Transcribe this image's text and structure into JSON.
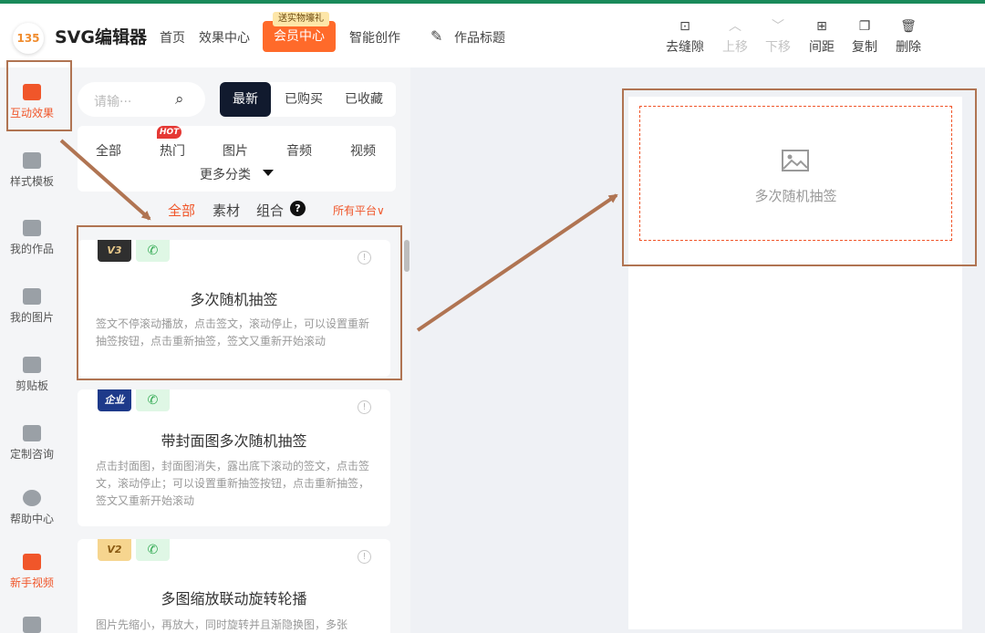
{
  "header": {
    "logo_text": "135",
    "brand": "SVG编辑器",
    "nav": [
      "首页",
      "效果中心"
    ],
    "vip_label": "会员中心",
    "vip_tag": "送实物壕礼",
    "nav2": "智能创作",
    "work_title": "作品标题",
    "tools": [
      {
        "label": "去缝隙",
        "icon": "⊡"
      },
      {
        "label": "上移",
        "icon": "︿"
      },
      {
        "label": "下移",
        "icon": "﹀"
      },
      {
        "label": "间距",
        "icon": "⊞"
      },
      {
        "label": "复制",
        "icon": "❐"
      },
      {
        "label": "删除",
        "icon": "🗑"
      }
    ]
  },
  "sidebar": {
    "items": [
      {
        "label": "互动效果"
      },
      {
        "label": "样式模板"
      },
      {
        "label": "我的作品"
      },
      {
        "label": "我的图片"
      },
      {
        "label": "剪贴板"
      },
      {
        "label": "定制咨询"
      },
      {
        "label": "帮助中心"
      },
      {
        "label": "新手视频"
      }
    ]
  },
  "panel": {
    "search_placeholder": "请输···",
    "tabs": [
      "最新",
      "已购买",
      "已收藏"
    ],
    "categories": [
      "全部",
      "热门",
      "图片",
      "音频",
      "视频"
    ],
    "hot_badge": "HOT",
    "more_categories": "更多分类",
    "filters": [
      "全部",
      "素材",
      "组合"
    ],
    "platform": "所有平台∨",
    "cards": [
      {
        "badge": "V3",
        "wx": "✆",
        "title": "多次随机抽签",
        "desc": "签文不停滚动播放，点击签文，滚动停止，可以设置重新抽签按钮，点击重新抽签，签文又重新开始滚动"
      },
      {
        "badge": "企业",
        "wx": "✆",
        "title": "带封面图多次随机抽签",
        "desc": "点击封面图，封面图消失，露出底下滚动的签文，点击签文，滚动停止；可以设置重新抽签按钮，点击重新抽签，签文又重新开始滚动"
      },
      {
        "badge": "V2",
        "wx": "✆",
        "title": "多图缩放联动旋转轮播",
        "desc": "图片先缩小，再放大，同时旋转并且渐隐换图，多张"
      }
    ]
  },
  "canvas": {
    "placeholder_label": "多次随机抽签"
  }
}
